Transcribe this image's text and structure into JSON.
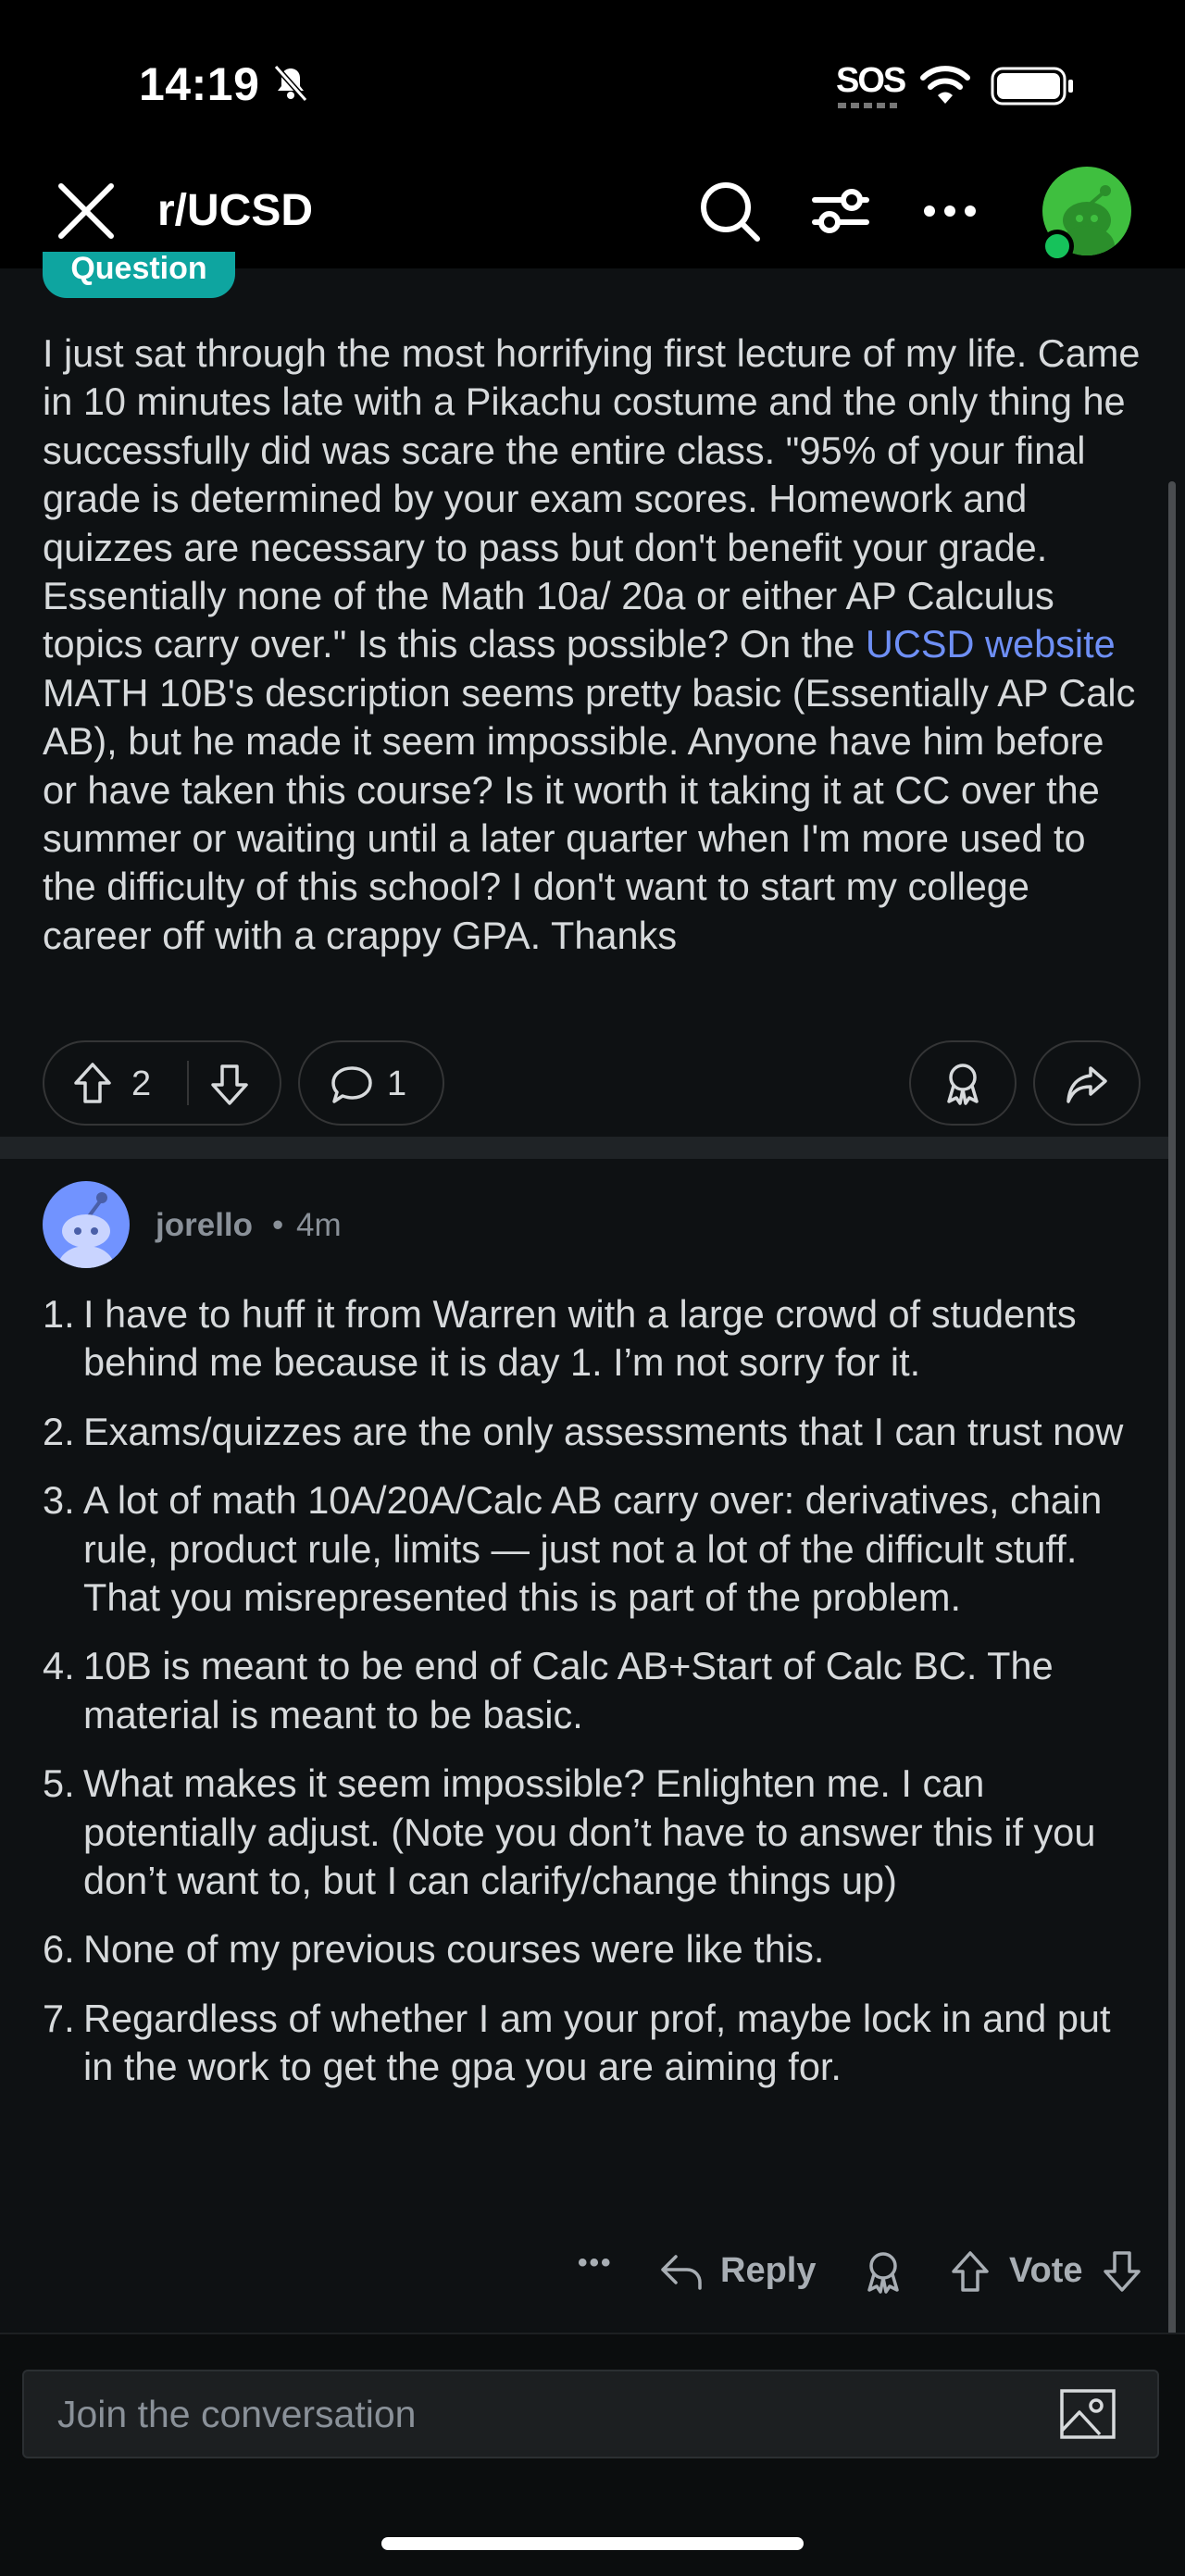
{
  "status_bar": {
    "time": "14:19",
    "sos": "SOS",
    "icons": [
      "bell-slash-icon",
      "wifi-icon",
      "battery-icon"
    ]
  },
  "nav": {
    "title": "r/UCSD",
    "icons": [
      "close-icon",
      "search-icon",
      "filter-icon",
      "more-icon",
      "avatar"
    ]
  },
  "post": {
    "flair": "Question",
    "body_before_link": "I just sat through the most horrifying first lecture of my life. Came in 10 minutes late with a Pikachu costume and the only thing he successfully did was scare the entire class. \"95% of your final grade is determined by your exam scores. Homework and quizzes are necessary to pass but don't benefit your grade. Essentially none of the Math 10a/ 20a or either AP Calculus topics carry over.\" Is this class possible? On the ",
    "link_text": "UCSD website",
    "body_after_link": " MATH 10B's description seems pretty basic (Essentially AP Calc AB), but he made it seem impossible. Anyone have him before or have taken this course? Is it worth it taking it at CC over the summer or waiting until a later quarter when I'm more used to the difficulty of this school? I don't want to start my college career off with a crappy GPA. Thanks",
    "votes": "2",
    "comments": "1"
  },
  "comment": {
    "author": "jorello",
    "separator": "•",
    "time": "4m",
    "items": [
      {
        "num": "1.",
        "text": "I have to huff it from Warren with a large crowd of students behind me because it is day 1. I’m not sorry for it."
      },
      {
        "num": "2.",
        "text": "Exams/quizzes are the only assessments that I can trust now"
      },
      {
        "num": "3.",
        "text": "A lot of math 10A/20A/Calc AB carry over: derivatives, chain rule, product rule, limits — just not a lot of the difficult stuff. That you misrepresented this is part of the problem."
      },
      {
        "num": "4.",
        "text": "10B is meant to be end of Calc AB+Start of Calc BC. The material is meant to be basic."
      },
      {
        "num": "5.",
        "text": "What makes it seem impossible? Enlighten me. I can potentially adjust. (Note you don’t have to answer this if you don’t want to, but I can clarify/change things up)"
      },
      {
        "num": "6.",
        "text": "None of my previous courses were like this."
      },
      {
        "num": "7.",
        "text": "Regardless of whether I am your prof, maybe lock in and put in the work to get the gpa you are aiming for."
      }
    ],
    "actions": {
      "more": "•••",
      "reply": "Reply",
      "vote": "Vote"
    }
  },
  "composer": {
    "placeholder": "Join the conversation"
  }
}
